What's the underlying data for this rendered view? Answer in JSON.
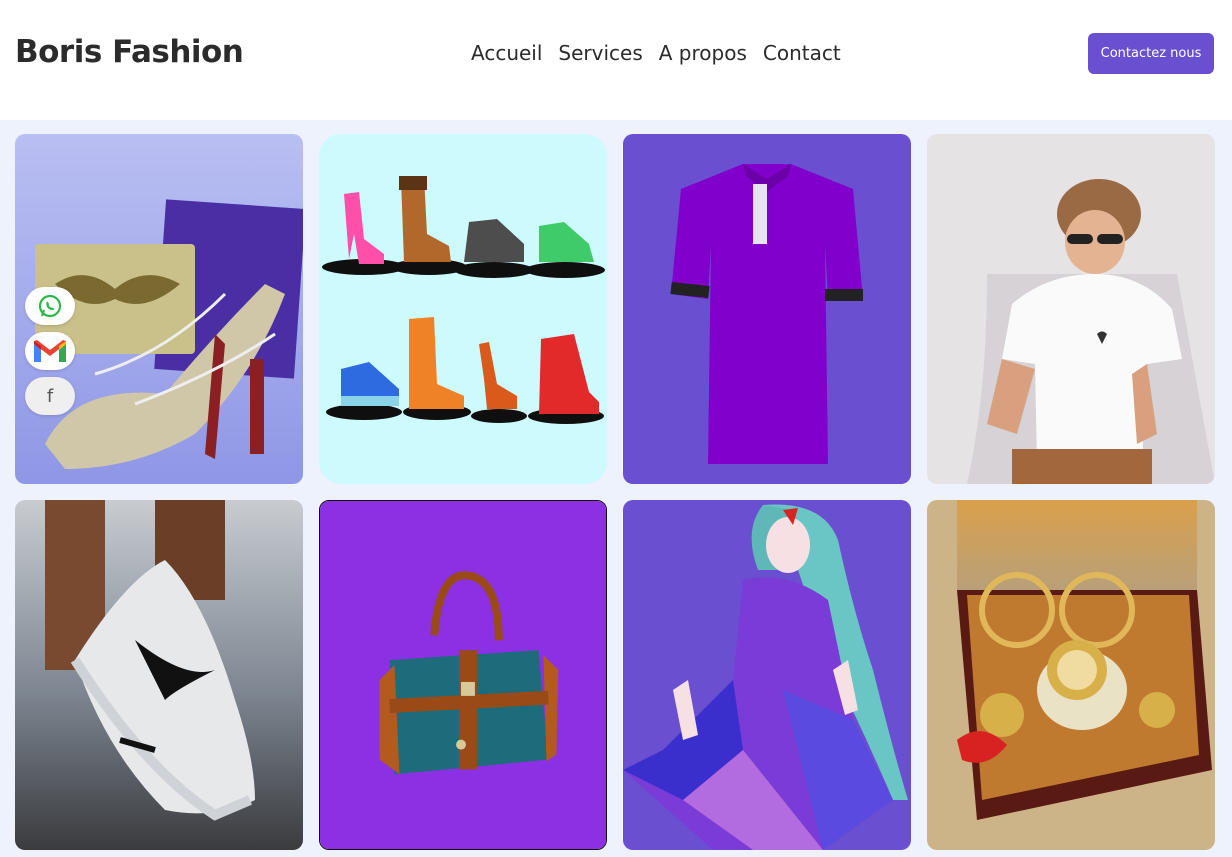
{
  "header": {
    "brand": "Boris Fashion",
    "nav": [
      {
        "label": "Accueil"
      },
      {
        "label": "Services"
      },
      {
        "label": "A propos"
      },
      {
        "label": "Contact"
      }
    ],
    "cta_label": "Contactez nous"
  },
  "social": [
    {
      "name": "whatsapp-icon"
    },
    {
      "name": "gmail-icon"
    },
    {
      "name": "facebook-icon",
      "glyph": "f"
    }
  ],
  "gallery": [
    {
      "name": "heels-and-clutch-photo"
    },
    {
      "name": "shoes-illustration"
    },
    {
      "name": "purple-polo-shirt"
    },
    {
      "name": "boy-white-tshirt-photo"
    },
    {
      "name": "sneakers-photo"
    },
    {
      "name": "teal-handbag"
    },
    {
      "name": "woman-dress-illustration"
    },
    {
      "name": "jewelry-box-photo"
    }
  ],
  "colors": {
    "accent": "#6a4fd1",
    "background": "#eef2fd"
  }
}
